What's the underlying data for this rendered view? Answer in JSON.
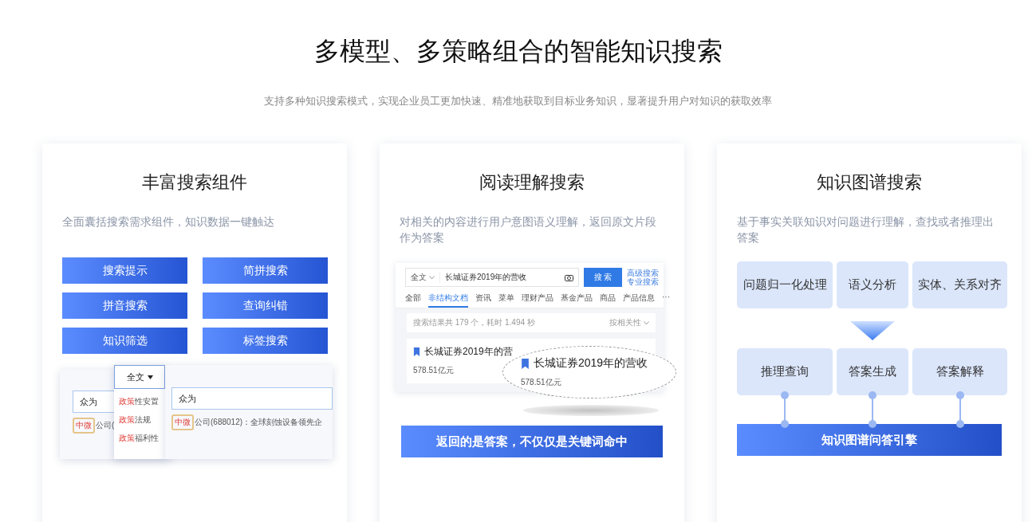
{
  "header": {
    "title": "多模型、多策略组合的智能知识搜索",
    "subtitle": "支持多种知识搜索模式，实现企业员工更加快速、精准地获取到目标业务知识，显著提升用户对知识的获取效率"
  },
  "cards": [
    {
      "kind": "components",
      "title": "丰富搜索组件",
      "description": "全面囊括搜索需求组件，知识数据一键触达",
      "buttons": [
        "搜索提示",
        "简拼搜索",
        "拼音搜索",
        "查询纠错",
        "知识筛选",
        "标签搜索"
      ],
      "demo": {
        "back": {
          "query": "众为",
          "hit": "中微",
          "rest": "公司("
        },
        "dropdown": {
          "scope": "全文",
          "items": [
            {
              "keyword": "政策",
              "rest": "性安置"
            },
            {
              "keyword": "政策",
              "rest": "法规"
            },
            {
              "keyword": "政策",
              "rest": "福利性"
            }
          ]
        },
        "front": {
          "query": "众为",
          "hit": "中微",
          "rest": "公司(688012)：全球刻蚀设备领先企"
        }
      }
    },
    {
      "kind": "reading",
      "title": "阅读理解搜索",
      "description": "对相关的内容进行用户意图语义理解，返回原文片段作为答案",
      "demo": {
        "scope": "全文",
        "query": "长城证券2019年的营收",
        "button": "搜 索",
        "links": [
          "高级搜索",
          "专业搜索"
        ],
        "tabs": [
          {
            "label": "全部",
            "selected": false
          },
          {
            "label": "非结构文档",
            "selected": true
          },
          {
            "label": "资讯",
            "selected": false
          },
          {
            "label": "菜单",
            "selected": false
          },
          {
            "label": "理财产品",
            "selected": false
          },
          {
            "label": "基金产品",
            "selected": false
          },
          {
            "label": "商品",
            "selected": false
          },
          {
            "label": "产品信息",
            "selected": false
          },
          {
            "label": "···",
            "selected": false
          }
        ],
        "stats": "搜索结果共 179 个，耗时 1.494 秒",
        "sort": "按相关性",
        "result": {
          "title": "长城证券2019年的营",
          "answer": "578.51亿元"
        },
        "lens": {
          "title": "长城证券2019年的营收",
          "answer": "578.51亿元"
        }
      },
      "banner": "返回的是答案，不仅仅是关键词命中"
    },
    {
      "kind": "graph",
      "title": "知识图谱搜索",
      "description": "基于事实关联知识对问题进行理解，查找或者推理出答案",
      "top_row": [
        "问题归一化处理",
        "语义分析",
        "实体、关系对齐"
      ],
      "bottom_row": [
        "推理查询",
        "答案生成",
        "答案解释"
      ],
      "banner": "知识图谱问答引擎"
    }
  ]
}
